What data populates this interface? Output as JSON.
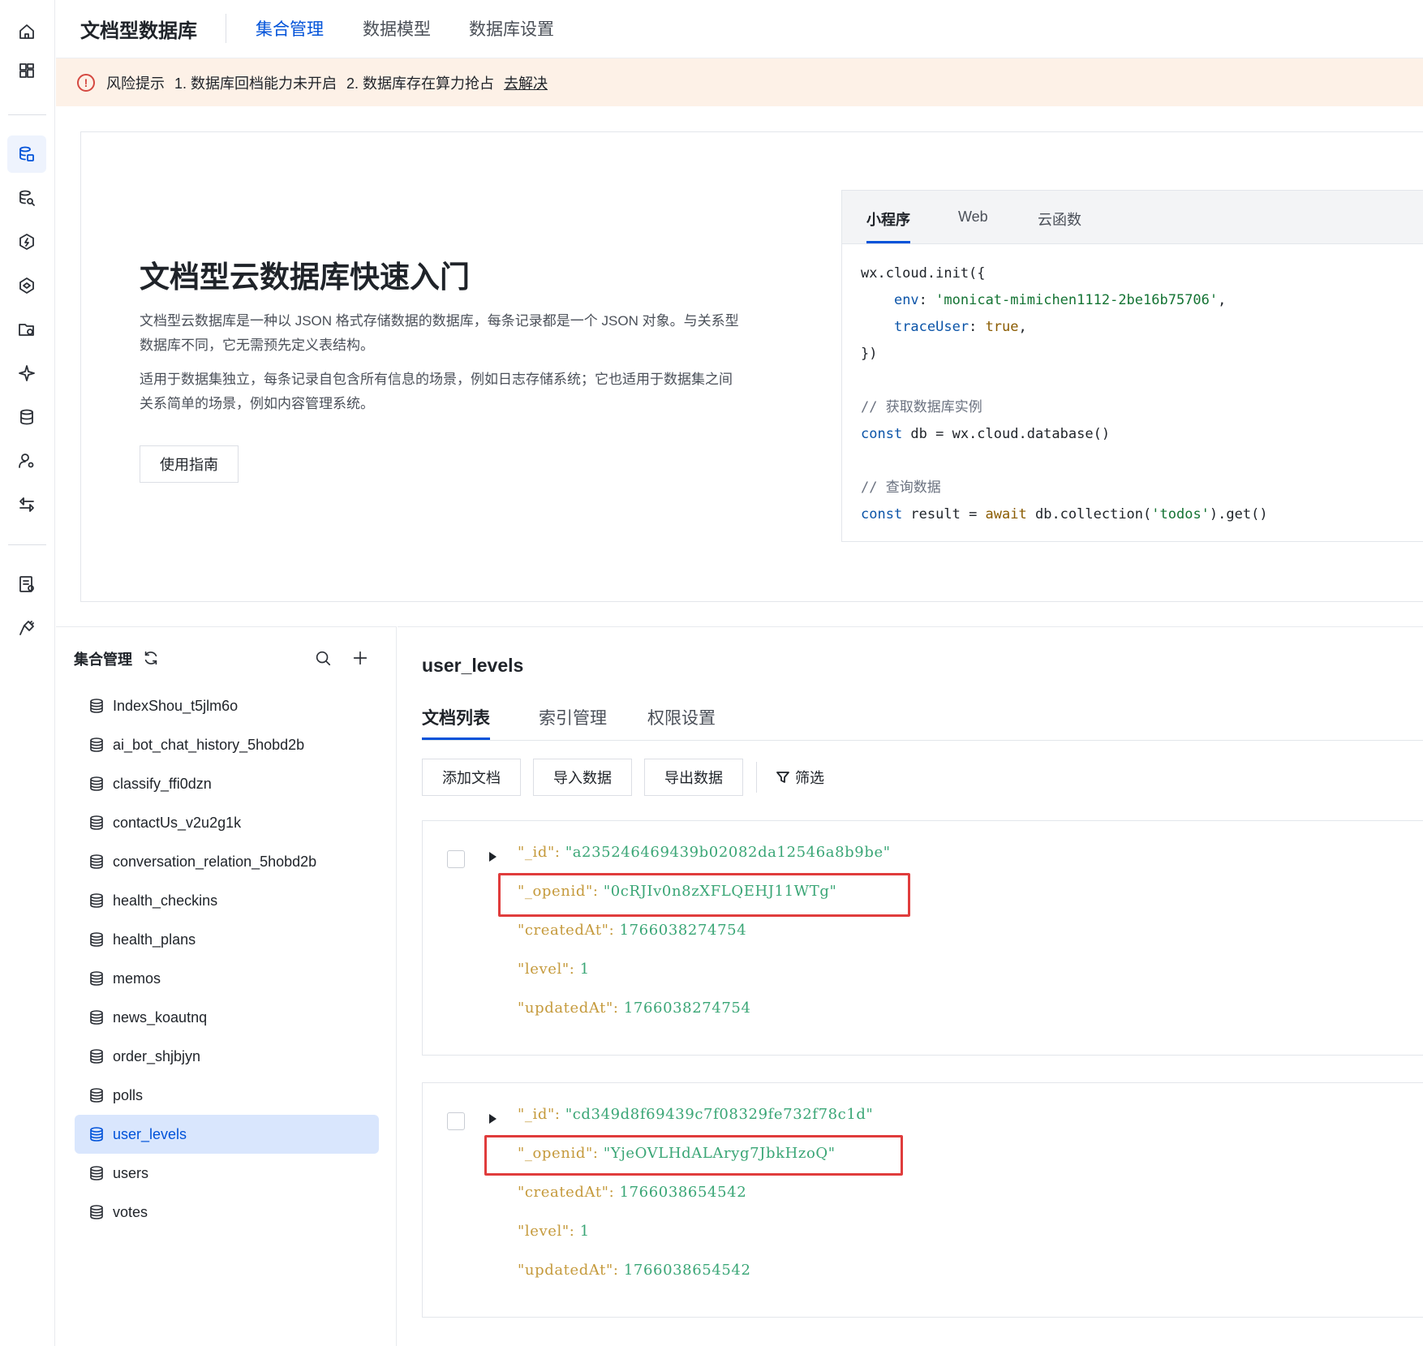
{
  "header": {
    "app_title": "文档型数据库",
    "tabs": [
      "集合管理",
      "数据模型",
      "数据库设置"
    ],
    "active_tab": "集合管理"
  },
  "banner": {
    "label": "风险提示",
    "item1": "1. 数据库回档能力未开启",
    "item2": "2. 数据库存在算力抢占",
    "link": "去解决"
  },
  "intro": {
    "title": "文档型云数据库快速入门",
    "p1": "文档型云数据库是一种以 JSON 格式存储数据的数据库，每条记录都是一个 JSON 对象。与关系型数据库不同，它无需预先定义表结构。",
    "p2": "适用于数据集独立，每条记录自包含所有信息的场景，例如日志存储系统；它也适用于数据集之间关系简单的场景，例如内容管理系统。",
    "guide_button": "使用指南"
  },
  "code_card": {
    "tabs": [
      "小程序",
      "Web",
      "云函数"
    ],
    "active_tab": "小程序",
    "env_value": "'monicat-mimichen1112-2be16b75706'",
    "comment1": "// 获取数据库实例",
    "comment2": "// 查询数据",
    "collection_name": "'todos'"
  },
  "collections": {
    "title": "集合管理",
    "items": [
      "IndexShou_t5jlm6o",
      "ai_bot_chat_history_5hobd2b",
      "classify_ffi0dzn",
      "contactUs_v2u2g1k",
      "conversation_relation_5hobd2b",
      "health_checkins",
      "health_plans",
      "memos",
      "news_koautnq",
      "order_shjbjyn",
      "polls",
      "user_levels",
      "users",
      "votes"
    ],
    "active": "user_levels"
  },
  "main": {
    "collection_name": "user_levels",
    "tabs": [
      "文档列表",
      "索引管理",
      "权限设置"
    ],
    "active_tab": "文档列表",
    "toolbar": {
      "add": "添加文档",
      "import": "导入数据",
      "export": "导出数据",
      "filter": "筛选"
    }
  },
  "documents": [
    {
      "_id": "\"a235246469439b02082da12546a8b9be\"",
      "_openid": "\"0cRJIv0n8zXFLQEHJ11WTg\"",
      "createdAt": "1766038274754",
      "level": "1",
      "updatedAt": "1766038274754"
    },
    {
      "_id": "\"cd349d8f69439c7f08329fe732f78c1d\"",
      "_openid": "\"YjeOVLHdALAryg7JbkHzoQ\"",
      "createdAt": "1766038654542",
      "level": "1",
      "updatedAt": "1766038654542"
    }
  ],
  "keys": {
    "id": "\"_id\"",
    "openid": "\"_openid\"",
    "created": "\"createdAt\"",
    "level": "\"level\"",
    "updated": "\"updatedAt\""
  },
  "colors": {
    "accent": "#0052d9",
    "banner_bg": "#fdf1e7",
    "highlight": "#e03c3c",
    "json_value": "#3aa676",
    "json_key": "#c59a3c"
  }
}
